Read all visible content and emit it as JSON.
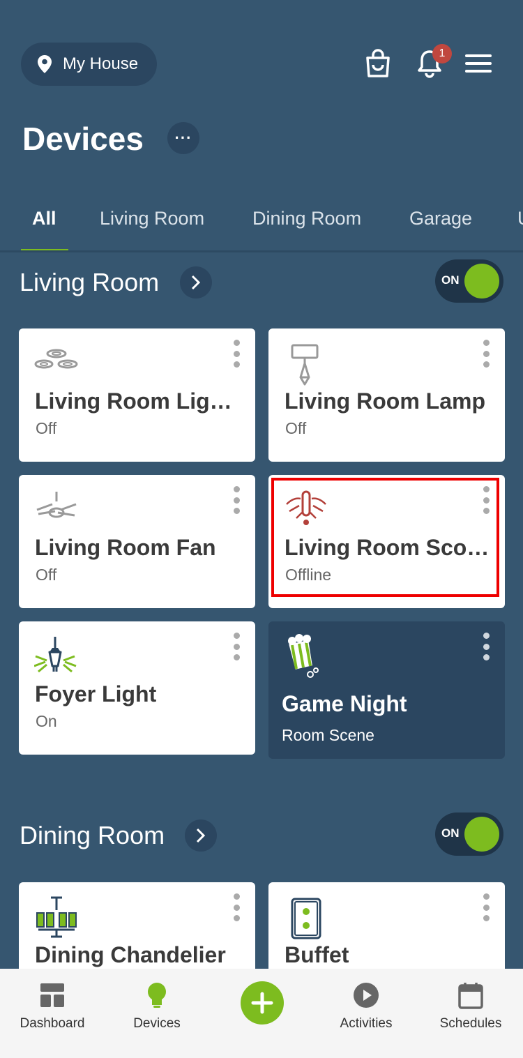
{
  "header": {
    "location_label": "My House",
    "notification_count": "1"
  },
  "page": {
    "title": "Devices",
    "more_label": "···"
  },
  "tabs": [
    {
      "label": "All",
      "active": true
    },
    {
      "label": "Living Room",
      "active": false
    },
    {
      "label": "Dining Room",
      "active": false
    },
    {
      "label": "Garage",
      "active": false
    },
    {
      "label": "U",
      "active": false
    }
  ],
  "sections": [
    {
      "title": "Living Room",
      "toggle_label": "ON",
      "cards": [
        {
          "name": "Living Room Ligh…",
          "status": "Off",
          "icon": "recessed-lights-icon"
        },
        {
          "name": "Living Room Lamp",
          "status": "Off",
          "icon": "lamp-icon"
        },
        {
          "name": "Living Room Fan",
          "status": "Off",
          "icon": "ceiling-fan-icon"
        },
        {
          "name": "Living Room Sco…",
          "status": "Offline",
          "icon": "sconce-offline-icon"
        },
        {
          "name": "Foyer Light",
          "status": "On",
          "icon": "pendant-light-icon"
        },
        {
          "name": "Game Night",
          "status": "Room Scene",
          "icon": "popcorn-icon"
        }
      ]
    },
    {
      "title": "Dining Room",
      "toggle_label": "ON",
      "cards": [
        {
          "name": "Dining Chandelier",
          "status": "",
          "icon": "chandelier-icon"
        },
        {
          "name": "Buffet",
          "status": "",
          "icon": "outlet-icon"
        }
      ]
    }
  ],
  "bottom_nav": [
    {
      "label": "Dashboard",
      "icon": "dashboard-icon"
    },
    {
      "label": "Devices",
      "icon": "bulb-icon"
    },
    {
      "label": "",
      "icon": "add-icon"
    },
    {
      "label": "Activities",
      "icon": "play-icon"
    },
    {
      "label": "Schedules",
      "icon": "calendar-icon"
    }
  ],
  "colors": {
    "background": "#365670",
    "accent_green": "#7dbc1f",
    "offline_red": "#b3403a",
    "highlight": "#e00000"
  }
}
